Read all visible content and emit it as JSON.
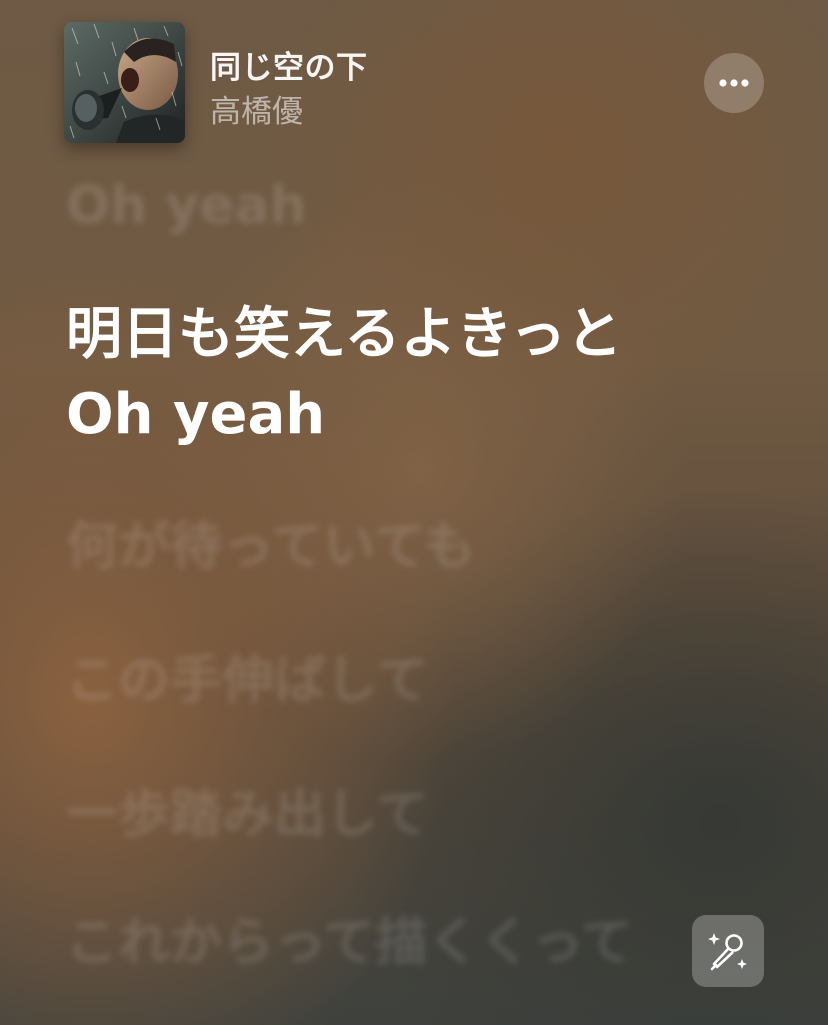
{
  "now_playing": {
    "title": "同じ空の下",
    "artist": "高橋優",
    "artwork_icon": "album-artwork-singer"
  },
  "controls": {
    "more_icon": "ellipsis-icon",
    "sing_icon": "microphone-sparkles-icon"
  },
  "lyrics": {
    "previous_line": "Oh yeah",
    "current_line_1": "明日も笑えるよきっと",
    "current_line_2": "Oh yeah",
    "upcoming": [
      "何が待っていても",
      "この手伸ばして",
      "一歩踏み出して",
      "これからって描くくって"
    ]
  },
  "colors": {
    "active_lyric": "#ffffff",
    "inactive_lyric": "rgba(255,255,255,0.14)",
    "background_warm": "#7a5d42",
    "background_dark": "#3e413d"
  }
}
